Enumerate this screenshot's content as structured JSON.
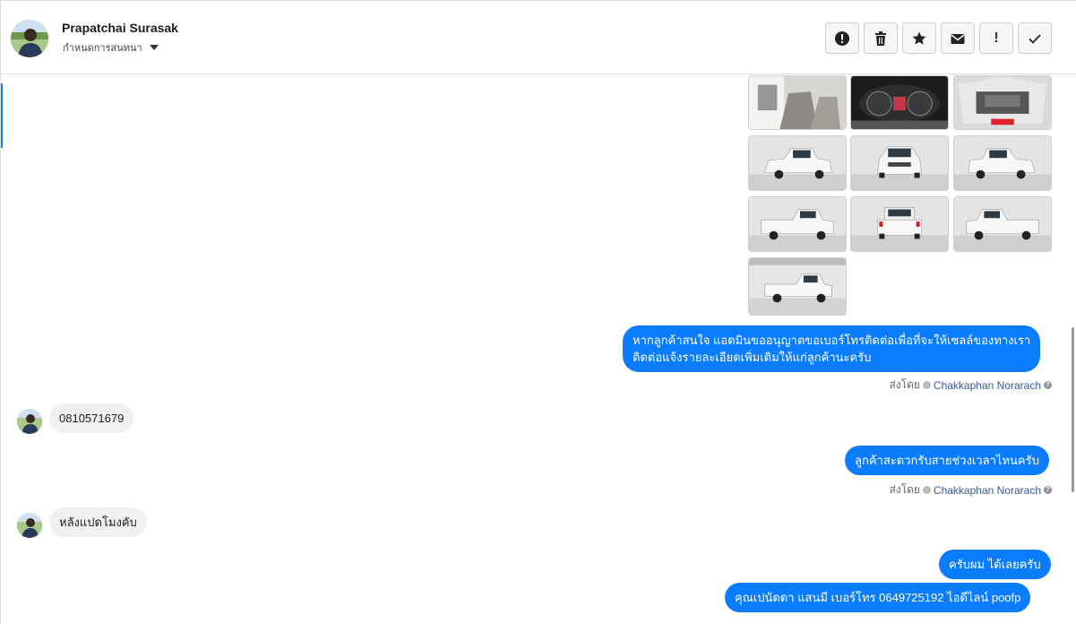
{
  "header": {
    "contact_name": "Prapatchai Surasak",
    "assign_label": "กำหนดการสนทนา",
    "actions": [
      {
        "name": "spam-alert-button",
        "icon": "alert-circle-icon"
      },
      {
        "name": "delete-button",
        "icon": "trash-icon"
      },
      {
        "name": "star-button",
        "icon": "star-icon"
      },
      {
        "name": "mark-unread-button",
        "icon": "envelope-icon"
      },
      {
        "name": "follow-up-button",
        "icon": "exclamation-icon"
      },
      {
        "name": "mark-done-button",
        "icon": "checkmark-icon"
      }
    ]
  },
  "colors": {
    "accent": "#1877f2",
    "outgoing_bubble": "#0a7cff",
    "incoming_bubble": "#f0f0f0",
    "agent_link": "#385898"
  },
  "messages": {
    "msg1": {
      "text_line1": "หากลูกค้าสนใจ แอดมินขออนุญาตขอเบอร์โทรติดต่อเพื่อที่จะให้เซลล์ของทางเรา",
      "text_line2": "ติดต่อแจ้งรายละเอียดเพิ่มเติมให้แก่ลูกค้านะครับ"
    },
    "msg1_sent": {
      "prefix": "ส่งโดย",
      "agent": "Chakkaphan Norarach"
    },
    "msg2": {
      "text": "0810571679"
    },
    "msg3": {
      "text": "ลูกค้าสะดวกรับสายช่วงเวลาไหนครับ"
    },
    "msg3_sent": {
      "prefix": "ส่งโดย",
      "agent": "Chakkaphan Norarach"
    },
    "msg4": {
      "text": "หลังแปดโมงคับ"
    },
    "msg5": {
      "text": "ครับผม ได้เลยครับ"
    },
    "msg6": {
      "text": "คุณเปนัดดา แสนมี   เบอร์โทร 0649725192  ไอดีไลน์ poofp"
    }
  },
  "photos": [
    {
      "name": "photo-interior-seats"
    },
    {
      "name": "photo-dashboard-gauges"
    },
    {
      "name": "photo-engine-bay"
    },
    {
      "name": "photo-pickup-front-left"
    },
    {
      "name": "photo-pickup-front"
    },
    {
      "name": "photo-pickup-front-right"
    },
    {
      "name": "photo-pickup-rear-left"
    },
    {
      "name": "photo-pickup-rear"
    },
    {
      "name": "photo-pickup-rear-right"
    },
    {
      "name": "photo-pickup-side"
    }
  ]
}
